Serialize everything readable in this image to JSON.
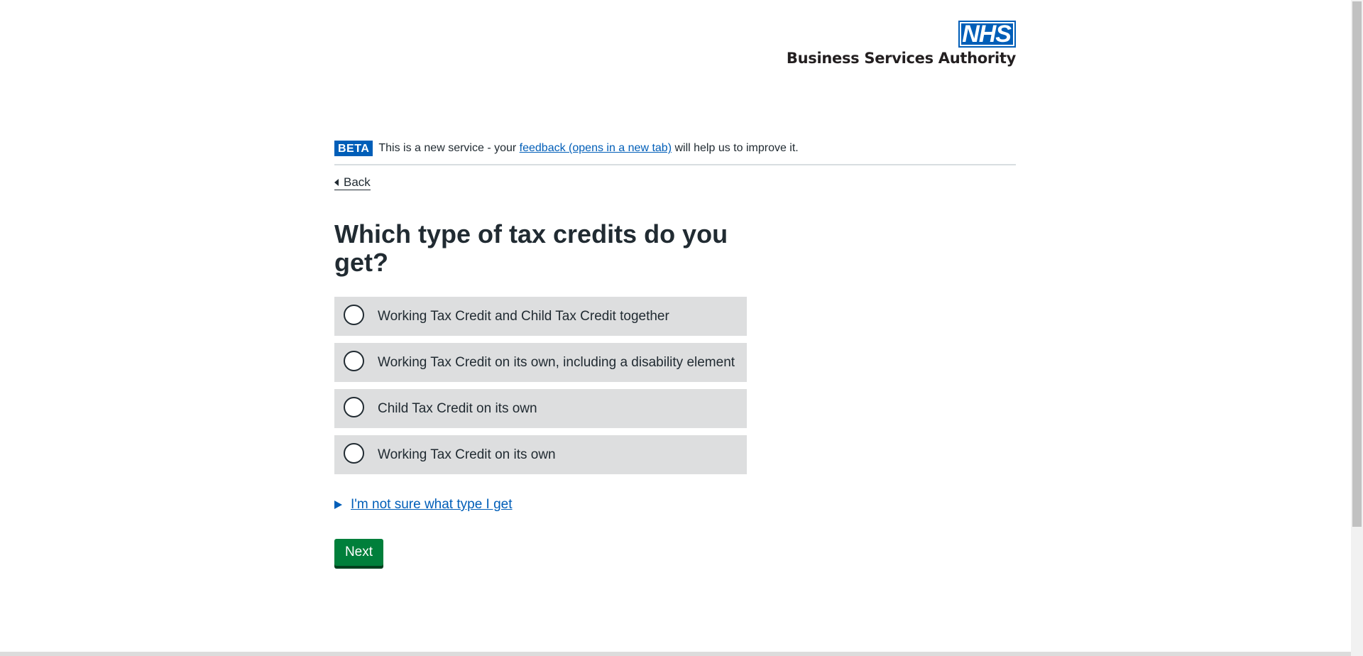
{
  "header": {
    "logo_mark": "NHS",
    "org_name": "Business Services Authority"
  },
  "phase_banner": {
    "tag": "BETA",
    "text_before": "This is a new service - your ",
    "link_text": "feedback (opens in a new tab)",
    "text_after": " will help us to improve it."
  },
  "back_link": "Back",
  "question": {
    "heading": "Which type of tax credits do you get?",
    "options": [
      {
        "label": "Working Tax Credit and Child Tax Credit together",
        "selected": false
      },
      {
        "label": "Working Tax Credit on its own, including a disability element",
        "selected": false
      },
      {
        "label": "Child Tax Credit on its own",
        "selected": false
      },
      {
        "label": "Working Tax Credit on its own",
        "selected": false
      }
    ]
  },
  "details": {
    "summary": "I'm not sure what type I get"
  },
  "next_button": "Next",
  "colors": {
    "nhs_blue": "#005eb8",
    "button_green": "#007f3b",
    "radio_background": "#dddedf",
    "text": "#212b32"
  }
}
